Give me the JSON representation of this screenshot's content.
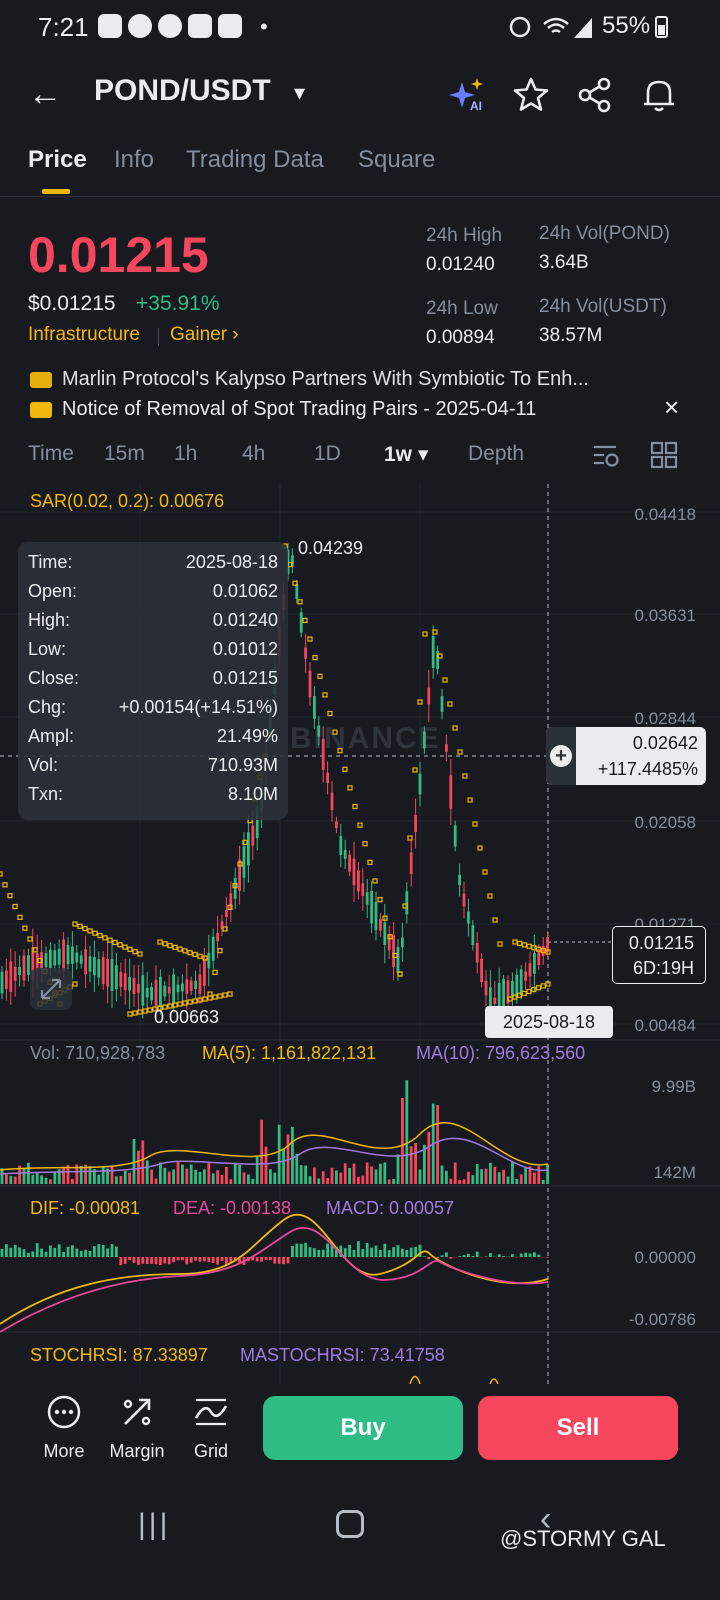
{
  "status_bar": {
    "time": "7:21",
    "dot": "•",
    "battery": "55%"
  },
  "header": {
    "pair": "POND/USDT",
    "caret": "▾",
    "back_glyph": "←"
  },
  "tabs": [
    "Price",
    "Info",
    "Trading Data",
    "Square"
  ],
  "price": {
    "last": "0.01215",
    "usd": "$0.01215",
    "change": "+35.91%",
    "tag_category": "Infrastructure",
    "tag_gainer": "Gainer ›"
  },
  "stats": {
    "high_label": "24h High",
    "high": "0.01240",
    "low_label": "24h Low",
    "low": "0.00894",
    "vol_pond_label": "24h Vol(POND)",
    "vol_pond": "3.64B",
    "vol_usdt_label": "24h Vol(USDT)",
    "vol_usdt": "38.57M"
  },
  "news": {
    "item1": "Marlin Protocol's Kalypso Partners With Symbiotic To Enh...",
    "item2": "Notice of Removal of Spot Trading Pairs - 2025-04-11",
    "close": "×"
  },
  "intervals": [
    "Time",
    "15m",
    "1h",
    "4h",
    "1D",
    "1w ▾",
    "Depth"
  ],
  "chart": {
    "sar_label": "SAR(0.02, 0.2): 0.00676",
    "axis": [
      "0.04418",
      "0.03631",
      "0.02844",
      "0.02058",
      "0.01271",
      "0.00484"
    ],
    "high_marker": "0.04239",
    "low_marker": "0.00663",
    "watermark": "BINANCE",
    "crosshair_price": "0.02642",
    "crosshair_pct": "+117.4485%",
    "last_price": "0.01215",
    "countdown": "6D:19H",
    "date_badge": "2025-08-18",
    "plus": "+"
  },
  "tooltip": {
    "rows": [
      {
        "k": "Time:",
        "v": "2025-08-18"
      },
      {
        "k": "Open:",
        "v": "0.01062"
      },
      {
        "k": "High:",
        "v": "0.01240"
      },
      {
        "k": "Low:",
        "v": "0.01012"
      },
      {
        "k": "Close:",
        "v": "0.01215"
      },
      {
        "k": "Chg:",
        "v": "+0.00154(+14.51%)"
      },
      {
        "k": "Ampl:",
        "v": "21.49%"
      },
      {
        "k": "Vol:",
        "v": "710.93M"
      },
      {
        "k": "Txn:",
        "v": "8.10M"
      }
    ]
  },
  "volume": {
    "vol": "Vol: 710,928,783",
    "ma5": "MA(5): 1,161,822,131",
    "ma10": "MA(10): 796,623,560",
    "axis_top": "9.99B",
    "axis_bottom": "142M"
  },
  "macd": {
    "dif": "DIF: -0.00081",
    "dea": "DEA: -0.00138",
    "macd": "MACD: 0.00057",
    "axis_top": "0.00000",
    "axis_bottom": "-0.00786"
  },
  "stochrsi": {
    "stoch": "STOCHRSI: 87.33897",
    "ma": "MASTOCHRSI: 73.41758"
  },
  "bottom": {
    "more": "More",
    "margin": "Margin",
    "grid": "Grid",
    "buy": "Buy",
    "sell": "Sell"
  },
  "nav": {
    "recents": "|||",
    "back": "‹"
  },
  "credit": "@STORMY GAL",
  "colors": {
    "bg": "#181a20",
    "up": "#2ebd85",
    "down": "#f6465d",
    "accent": "#f0b90b",
    "muted": "#848e9c",
    "purple": "#9f7be0"
  },
  "icons": [
    "back-icon",
    "caret-down-icon",
    "ai-sparkle-icon",
    "star-icon",
    "share-icon",
    "bell-icon",
    "close-icon",
    "indicator-settings-icon",
    "layout-grid-icon",
    "expand-icon",
    "more-icon",
    "margin-icon",
    "grid-icon"
  ]
}
